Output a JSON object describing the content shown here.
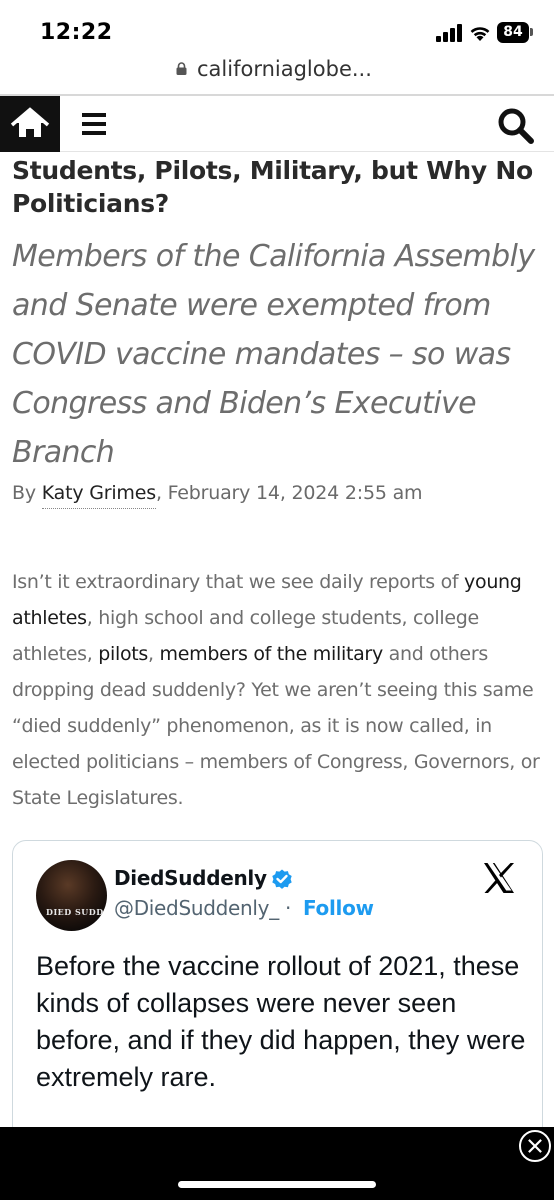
{
  "status_bar": {
    "time": "12:22",
    "battery": "84"
  },
  "browser": {
    "url": "californiaglobe..."
  },
  "site_nav": {
    "home_icon": "home-icon",
    "menu_icon": "hamburger-menu-icon",
    "search_icon": "search-icon"
  },
  "article": {
    "headline": "Students, Pilots, Military, but Why No Politicians?",
    "subheadline": "Members of the California Assembly and Senate were exempted from COVID vaccine mandates – so was Congress and Biden’s Executive Branch",
    "byline_prefix": "By ",
    "author": "Katy Grimes",
    "date": ", February 14, 2024 2:55 am",
    "body": {
      "t1": "Isn’t it extraordinary that we see daily reports of ",
      "link1": "young athletes",
      "t2": ", high school and college students, college athletes, ",
      "link2": "pilots",
      "t3": ", ",
      "link3": "members of the military",
      "t4": " and others dropping dead suddenly? Yet we aren’t seeing this same “died suddenly” phenomenon, as it is now called, in elected politicians – members of Congress, Governors, or State Legislatures."
    }
  },
  "tweet": {
    "avatar_text": "DIED SUDDENLY",
    "display_name": "DiedSuddenly",
    "handle": "@DiedSuddenly_",
    "separator": " · ",
    "follow_label": "Follow",
    "text": "Before the vaccine rollout of 2021, these kinds of collapses were never seen before, and if they did happen, they were extremely rare.",
    "verified_color": "#1d9bf0",
    "logo_icon": "x-logo-icon"
  },
  "overlay": {
    "close_icon": "close-circle-icon"
  }
}
